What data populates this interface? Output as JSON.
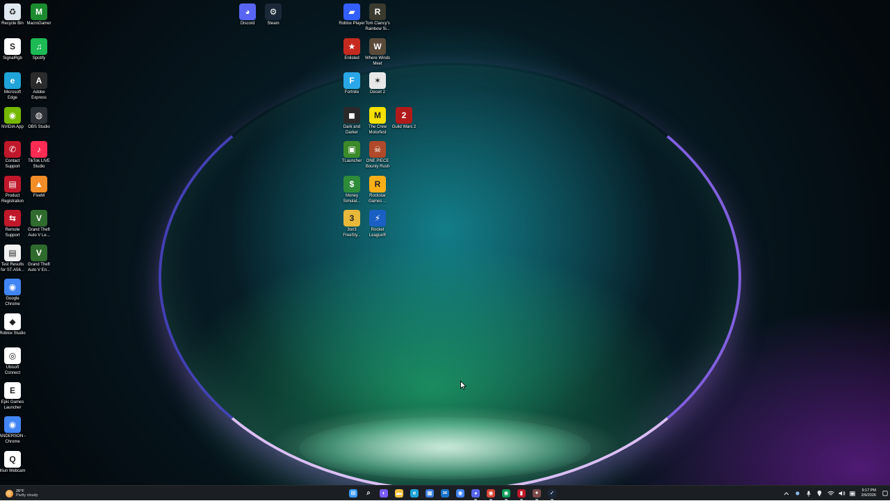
{
  "desktop": {
    "icons": [
      {
        "label": "Recycle Bin",
        "icon": "recycle-bin-icon",
        "color": "#dfe7ef"
      },
      {
        "label": "MacroGamer",
        "icon": "macrogamer-icon",
        "color": "#1c8a2e"
      },
      {
        "label": "SignalRgb",
        "icon": "signalrgb-icon",
        "color": "#ffffff"
      },
      {
        "label": "Spotify",
        "icon": "spotify-icon",
        "color": "#1db954"
      },
      {
        "label": "Microsoft Edge",
        "icon": "edge-icon",
        "color": "#1fa3d8"
      },
      {
        "label": "Adobe Express",
        "icon": "adobe-express-icon",
        "color": "#2b2b2b"
      },
      {
        "label": "NVIDIA App",
        "icon": "nvidia-icon",
        "color": "#76b900"
      },
      {
        "label": "OBS Studio",
        "icon": "obs-icon",
        "color": "#2a2e35"
      },
      {
        "label": "Contact Support",
        "icon": "support-icon",
        "color": "#c0182a"
      },
      {
        "label": "TikTok LIVE Studio",
        "icon": "tiktok-icon",
        "color": "#fe2c55"
      },
      {
        "label": "Product Registration",
        "icon": "registration-icon",
        "color": "#c0182a"
      },
      {
        "label": "FiveM",
        "icon": "fivem-icon",
        "color": "#f38d27"
      },
      {
        "label": "Remote Support",
        "icon": "remote-support-icon",
        "color": "#c0182a"
      },
      {
        "label": "Grand Theft Auto V Le...",
        "icon": "gtav-icon",
        "color": "#2f6b2e"
      },
      {
        "label": "Test Results for ST-A56...",
        "icon": "document-icon",
        "color": "#f2f2f2"
      },
      {
        "label": "Grand Theft Auto V En...",
        "icon": "gtav-icon",
        "color": "#2f6b2e"
      },
      {
        "label": "Google Chrome",
        "icon": "chrome-icon",
        "color": "#4285f4"
      },
      {
        "label": "Roblox Studio",
        "icon": "roblox-studio-icon",
        "color": "#ffffff"
      },
      {
        "label": "Ubisoft Connect",
        "icon": "ubisoft-icon",
        "color": "#ffffff"
      },
      {
        "label": "Epic Games Launcher",
        "icon": "epic-games-icon",
        "color": "#ffffff"
      },
      {
        "label": "ANDERSON - Chrome",
        "icon": "chrome-profile-icon",
        "color": "#4285f4"
      },
      {
        "label": "Iriun Webcam",
        "icon": "iriun-icon",
        "color": "#ffffff"
      },
      {
        "label": "Discord",
        "icon": "discord-icon",
        "color": "#5865f2"
      },
      {
        "label": "Steam",
        "icon": "steam-icon",
        "color": "#1b2838"
      },
      {
        "label": "Roblox Player",
        "icon": "roblox-icon",
        "color": "#335fff"
      },
      {
        "label": "Tom Clancy's Rainbow Si...",
        "icon": "rainbow-six-icon",
        "color": "#3a3a2e"
      },
      {
        "label": "Enlisted",
        "icon": "enlisted-icon",
        "color": "#c62a1e"
      },
      {
        "label": "Where Winds Meet",
        "icon": "where-winds-meet-icon",
        "color": "#5a4a3a"
      },
      {
        "label": "Fortnite",
        "icon": "fortnite-icon",
        "color": "#2aa7e8"
      },
      {
        "label": "Deceit 2",
        "icon": "deceit-icon",
        "color": "#e8e8e8"
      },
      {
        "label": "Dark and Darker",
        "icon": "dark-and-darker-icon",
        "color": "#2a2a2a"
      },
      {
        "label": "The Crew Motorfest",
        "icon": "crew-motorfest-icon",
        "color": "#f5e000"
      },
      {
        "label": "Guild Wars 2",
        "icon": "guild-wars-icon",
        "color": "#b01a1a"
      },
      {
        "label": "TLauncher",
        "icon": "tlauncher-icon",
        "color": "#3d8a2a"
      },
      {
        "label": "ONE PIECE Bounty Rush",
        "icon": "one-piece-icon",
        "color": "#b04a2a"
      },
      {
        "label": "Money Simulat...",
        "icon": "money-simulator-icon",
        "color": "#2e8b3a"
      },
      {
        "label": "Rockstar Games ...",
        "icon": "rockstar-icon",
        "color": "#fcaf17"
      },
      {
        "label": "3on3 FreeSty...",
        "icon": "freestyle-icon",
        "color": "#e8b83a"
      },
      {
        "label": "Rocket League®",
        "icon": "rocket-league-icon",
        "color": "#1a5fc4"
      }
    ]
  },
  "taskbar": {
    "weather": {
      "temp": "26°F",
      "condition": "Partly cloudy"
    },
    "apps": [
      {
        "name": "start-button",
        "icon": "windows-icon",
        "color": "#3a9bff",
        "glyph": "⊞"
      },
      {
        "name": "search-button",
        "icon": "search-icon",
        "color": "transparent",
        "glyph": "⌕"
      },
      {
        "name": "copilot-button",
        "icon": "copilot-icon",
        "color": "#7b5cff",
        "glyph": "◐"
      },
      {
        "name": "file-explorer-button",
        "icon": "folder-icon",
        "color": "#f4c242",
        "glyph": "▬"
      },
      {
        "name": "edge-button",
        "icon": "edge-icon",
        "color": "#1fa3d8",
        "glyph": "e"
      },
      {
        "name": "store-button",
        "icon": "store-icon",
        "color": "#3b7ddd",
        "glyph": "▦"
      },
      {
        "name": "outlook-button",
        "icon": "mail-icon",
        "color": "#1a73c8",
        "glyph": "✉"
      },
      {
        "name": "chrome-button",
        "icon": "chrome-icon",
        "color": "#4285f4",
        "glyph": "◉"
      },
      {
        "name": "discord-button",
        "icon": "discord-icon",
        "color": "#5865f2",
        "glyph": "◕"
      },
      {
        "name": "chrome-profile-button",
        "icon": "chrome-profile-icon",
        "color": "#db4437",
        "glyph": "◉"
      },
      {
        "name": "chrome-profile2-button",
        "icon": "chrome-profile-icon",
        "color": "#0f9d58",
        "glyph": "◉"
      },
      {
        "name": "app-red-button",
        "icon": "app-icon",
        "color": "#c0182a",
        "glyph": "▮"
      },
      {
        "name": "app-tools-button",
        "icon": "tools-icon",
        "color": "#7a4a4a",
        "glyph": "✦"
      },
      {
        "name": "steam-button",
        "icon": "steam-icon",
        "color": "#1b2838",
        "glyph": "✓"
      }
    ],
    "tray": {
      "time": "9:17 PM",
      "date": "2/9/2026"
    }
  }
}
